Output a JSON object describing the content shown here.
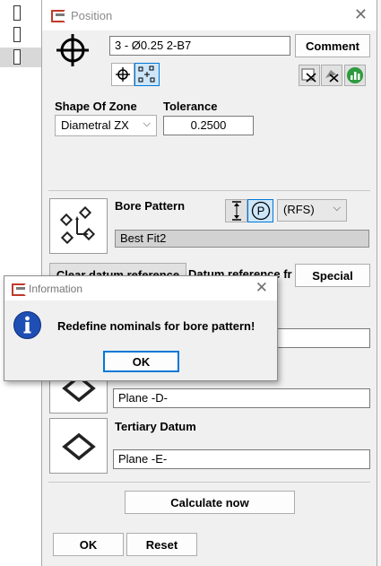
{
  "window": {
    "title": "Position"
  },
  "feature": {
    "name": "3 - Ø0.25 2-B7",
    "comment_label": "Comment"
  },
  "zone": {
    "shape_label": "Shape Of Zone",
    "shape_value": "Diametral ZX",
    "tolerance_label": "Tolerance",
    "tolerance_value": "0.2500"
  },
  "bore": {
    "label": "Bore Pattern",
    "modifier_value": "(RFS)",
    "fit_value": "Best Fit2",
    "p_symbol": "P"
  },
  "datum": {
    "clear_label": "Clear datum reference",
    "frame_label": "Datum reference fr",
    "special_label": "Special",
    "secondary_value": "Plane -D-",
    "tertiary_label": "Tertiary Datum",
    "tertiary_value": "Plane -E-"
  },
  "actions": {
    "calculate_label": "Calculate now",
    "ok_label": "OK",
    "reset_label": "Reset"
  },
  "info_dialog": {
    "title": "Information",
    "message": "Redefine nominals for bore pattern!",
    "ok_label": "OK"
  },
  "colors": {
    "accent": "#0078d7",
    "info_blue": "#1f4fb4",
    "green": "#2e9b3e"
  }
}
